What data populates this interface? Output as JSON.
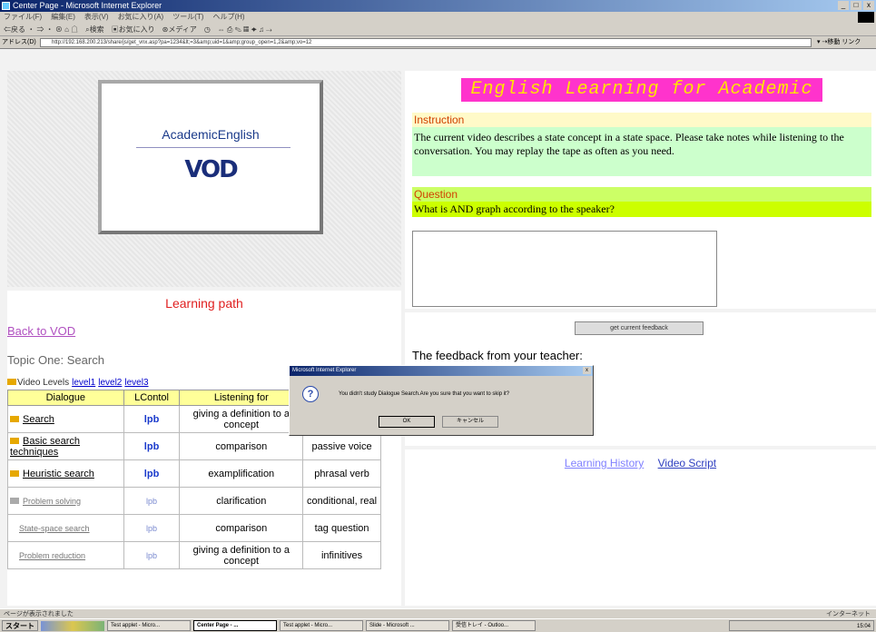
{
  "window": {
    "title": "Center Page - Microsoft Internet Explorer",
    "menu": [
      "ファイル(F)",
      "編集(E)",
      "表示(V)",
      "お気に入り(A)",
      "ツール(T)",
      "ヘルプ(H)"
    ],
    "toolbar": [
      "⇐戻る ・ ⇒ ・ ⊗ ⌂ ☖",
      "⌕検索",
      "▣お気に入り",
      "⊛メディア",
      "◷",
      "⇔ ⎙ ✎ ▦ ✦ ♫ ⇢"
    ],
    "address_label": "アドレス(D)",
    "address_url": "http://192.168.200.213/share/js/get_vnx.asp?pa=1234&lt;=3&amp;uid=1&amp;group_open=1,2&amp;vo=12",
    "go_label": "▾ ⇢移動 リンク"
  },
  "video": {
    "title": "AcademicEnglish",
    "logo": "VOD"
  },
  "lesson": {
    "title": "English Learning for Academic",
    "instruction_heading": "Instruction",
    "instruction_text": "The current video describes a state concept in a state space. Please take notes while listening to the conversation. You may replay the tape as often as you need.",
    "question_heading": "Question",
    "question_text": "What is AND graph according to the speaker?",
    "answer_value": ""
  },
  "path": {
    "title": "Learning path",
    "back_link": "Back to VOD",
    "topic": "Topic One:  Search",
    "levels_label": "Video Levels",
    "levels": [
      "level1",
      "level2",
      "level3"
    ],
    "headers": [
      "Dialogue",
      "LContol",
      "Listening for",
      ""
    ],
    "rows": [
      {
        "dialogue": "Search",
        "lcontrol": "lpb",
        "listening": "giving a definition to a concept",
        "grammar": ""
      },
      {
        "dialogue": "Basic search techniques",
        "lcontrol": "lpb",
        "listening": "comparison",
        "grammar": "passive voice"
      },
      {
        "dialogue": "Heuristic search",
        "lcontrol": "lpb",
        "listening": "examplification",
        "grammar": "phrasal verb"
      },
      {
        "dialogue": "Problem solving",
        "lcontrol": "lpb",
        "listening": "clarification",
        "grammar": "conditional, real"
      },
      {
        "dialogue": "State-space search",
        "lcontrol": "lpb",
        "listening": "comparison",
        "grammar": "tag question"
      },
      {
        "dialogue": "Problem reduction",
        "lcontrol": "lpb",
        "listening": "giving a definition to a concept",
        "grammar": "infinitives"
      }
    ]
  },
  "feedback": {
    "button_label": "get current feedback",
    "label": "The feedback from your teacher:"
  },
  "history": {
    "learning_history": "Learning History",
    "video_script": "Video Script"
  },
  "dialog": {
    "title": "Microsoft Internet Explorer",
    "message": "You didn't study Dialogue Search.Are you sure that you want to skip it?",
    "ok": "OK",
    "cancel": "キャンセル",
    "close": "x"
  },
  "status": {
    "text": "ページが表示されました",
    "zone": "インターネット"
  },
  "taskbar": {
    "start": "スタート",
    "tasks": [
      "Test applet - Micro...",
      "Center Page - ...",
      "Test applet - Micro...",
      "Slide - Microsoft ...",
      "受信トレイ - Outloo..."
    ],
    "tray": "15:04"
  }
}
